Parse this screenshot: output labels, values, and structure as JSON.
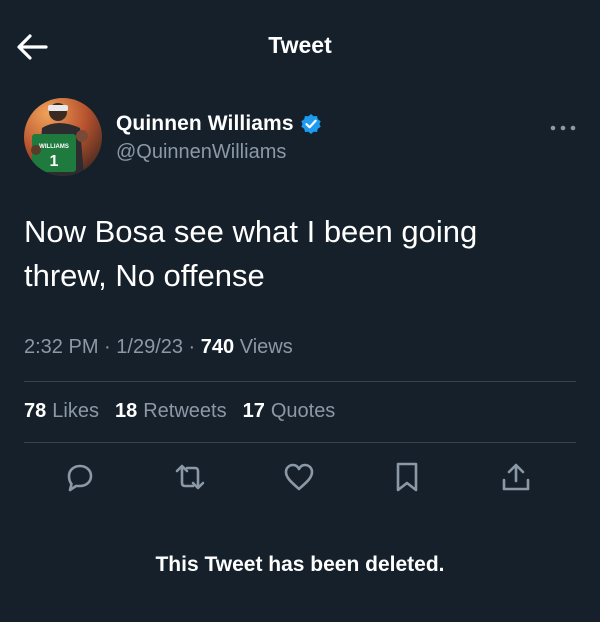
{
  "header": {
    "title": "Tweet",
    "back_icon": "arrow-left-icon"
  },
  "author": {
    "name": "Quinnen Williams",
    "handle": "@QuinnenWilliams",
    "verified_icon": "verified-badge-icon",
    "avatar_jersey_text": "WILLIAMS",
    "avatar_jersey_number": "1"
  },
  "tweet": {
    "line1": "Now Bosa see what I been going",
    "line2": "threw, No offense"
  },
  "meta": {
    "time": "2:32 PM",
    "sep1": " · ",
    "date": "1/29/23",
    "sep2": " · ",
    "views_count": "740",
    "views_label": " Views"
  },
  "stats": {
    "likes_count": "78",
    "likes_label": "Likes",
    "retweets_count": "18",
    "retweets_label": "Retweets",
    "quotes_count": "17",
    "quotes_label": "Quotes"
  },
  "actions": [
    "reply-icon",
    "retweet-icon",
    "like-icon",
    "bookmark-icon",
    "share-icon"
  ],
  "notice": "This Tweet has been deleted.",
  "colors": {
    "background": "#15202b",
    "secondary_text": "#8b98a5",
    "divider": "#38444d",
    "verified": "#1d9bf0",
    "jersey_green": "#1f7a3d"
  }
}
